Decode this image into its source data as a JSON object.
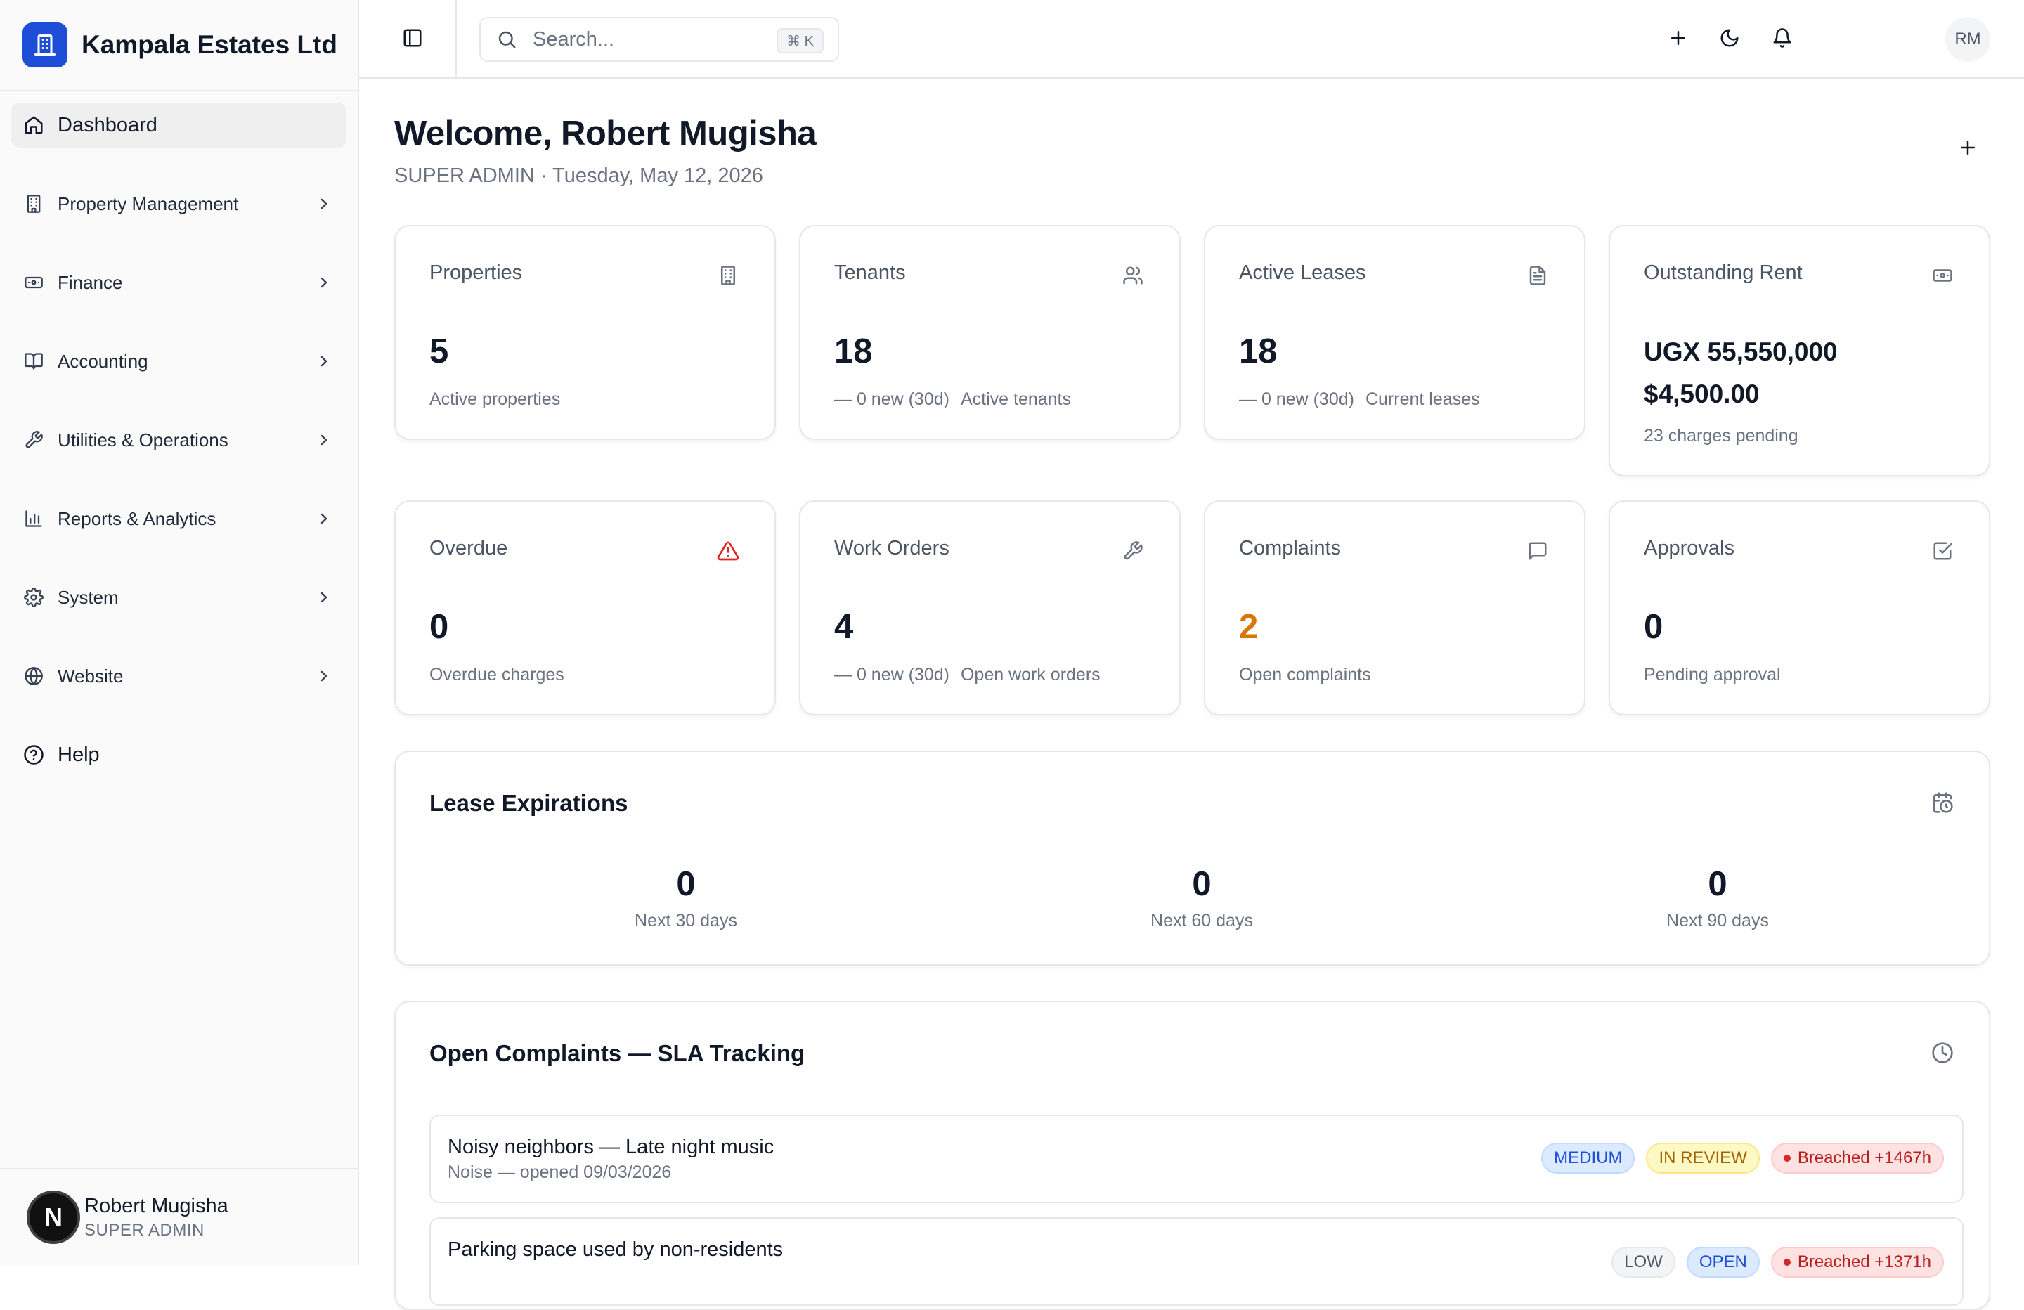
{
  "brand": {
    "name": "Kampala Estates Ltd"
  },
  "sidebar": {
    "items": [
      {
        "label": "Dashboard",
        "icon": "home-icon"
      },
      {
        "label": "Property Management",
        "icon": "building-icon"
      },
      {
        "label": "Finance",
        "icon": "banknote-icon"
      },
      {
        "label": "Accounting",
        "icon": "book-icon"
      },
      {
        "label": "Utilities & Operations",
        "icon": "wrench-icon"
      },
      {
        "label": "Reports & Analytics",
        "icon": "bar-chart-icon"
      },
      {
        "label": "System",
        "icon": "gear-icon"
      },
      {
        "label": "Website",
        "icon": "globe-icon"
      },
      {
        "label": "Help",
        "icon": "help-circle-icon"
      }
    ],
    "user": {
      "initial": "N",
      "name": "Robert Mugisha",
      "role": "SUPER ADMIN"
    }
  },
  "topbar": {
    "search_placeholder": "Search...",
    "search_shortcut": "⌘ K",
    "avatar_initials": "RM"
  },
  "header": {
    "title": "Welcome, Robert Mugisha",
    "subtitle": "SUPER ADMIN · Tuesday, May 12, 2026"
  },
  "stats": {
    "properties": {
      "title": "Properties",
      "value": "5",
      "sub": "Active properties"
    },
    "tenants": {
      "title": "Tenants",
      "value": "18",
      "delta": "— 0 new (30d)",
      "sub": "Active tenants"
    },
    "leases": {
      "title": "Active Leases",
      "value": "18",
      "delta": "— 0 new (30d)",
      "sub": "Current leases"
    },
    "outstanding": {
      "title": "Outstanding Rent",
      "ugx": "UGX 55,550,000",
      "usd": "$4,500.00",
      "sub": "23 charges pending"
    },
    "overdue": {
      "title": "Overdue",
      "value": "0",
      "sub": "Overdue charges"
    },
    "work_orders": {
      "title": "Work Orders",
      "value": "4",
      "delta": "— 0 new (30d)",
      "sub": "Open work orders"
    },
    "complaints": {
      "title": "Complaints",
      "value": "2",
      "sub": "Open complaints"
    },
    "approvals": {
      "title": "Approvals",
      "value": "0",
      "sub": "Pending approval"
    }
  },
  "lease_expirations": {
    "title": "Lease Expirations",
    "cols": [
      {
        "value": "0",
        "label": "Next 30 days"
      },
      {
        "value": "0",
        "label": "Next 60 days"
      },
      {
        "value": "0",
        "label": "Next 90 days"
      }
    ]
  },
  "sla": {
    "title": "Open Complaints — SLA Tracking",
    "rows": [
      {
        "title": "Noisy neighbors — Late night music",
        "sub": "Noise — opened 09/03/2026",
        "priority": "MEDIUM",
        "status": "IN REVIEW",
        "sla": "Breached +1467h"
      },
      {
        "title": "Parking space used by non-residents",
        "sub": "",
        "priority": "LOW",
        "status": "OPEN",
        "sla": "Breached +1371h"
      }
    ]
  },
  "colors": {
    "brand": "#1d4ed8",
    "danger": "#dc2626",
    "warning": "#d97706"
  }
}
